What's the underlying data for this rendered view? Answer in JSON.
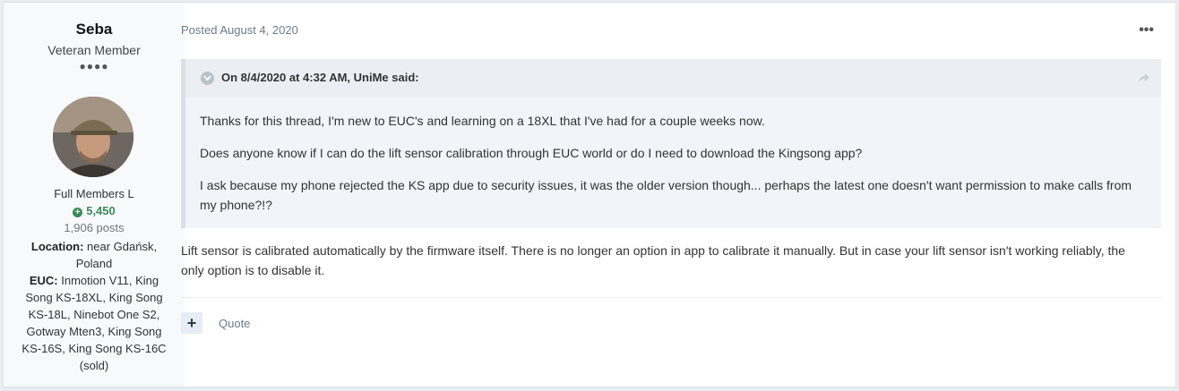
{
  "author": {
    "name": "Seba",
    "title": "Veteran Member",
    "pips": "●●●●",
    "group": "Full Members L",
    "reputation": "5,450",
    "posts": "1,906 posts",
    "location_label": "Location:",
    "location_value": " near Gdańsk, Poland",
    "euc_label": "EUC:",
    "euc_value": " Inmotion V11, King Song KS-18XL, King Song KS-18L, Ninebot One S2, Gotway Mten3, King Song KS-16S, King Song KS-16C (sold)"
  },
  "post": {
    "date": "Posted August 4, 2020",
    "more_glyph": "•••",
    "quote": {
      "citation": "On 8/4/2020 at 4:32 AM, UniMe said:",
      "paragraphs": [
        "Thanks for this thread, I'm new to EUC's and learning on a 18XL that I've had for a couple weeks now.",
        "Does anyone know if I can do the lift sensor calibration through EUC world or do I need to download the Kingsong app?",
        "I ask because my phone rejected the KS app due to security issues, it was the older version though... perhaps the latest one doesn't want permission to make calls from my phone?!?"
      ]
    },
    "body": "Lift sensor is calibrated automatically by the firmware itself. There is no longer an option in app to calibrate it manually. But in case your lift sensor isn't working reliably, the only option is to disable it."
  },
  "actions": {
    "plus_glyph": "+",
    "quote_label": "Quote"
  },
  "icons": {
    "avatar": "user-avatar-photo",
    "toggle": "chevron-down-icon",
    "share": "share-icon",
    "more": "more-options-icon",
    "rep": "plus-circle-icon"
  },
  "colors": {
    "reputation": "#3a8b5a",
    "meta_text": "#6b7b8c",
    "quote_bg": "#f1f4f8"
  }
}
